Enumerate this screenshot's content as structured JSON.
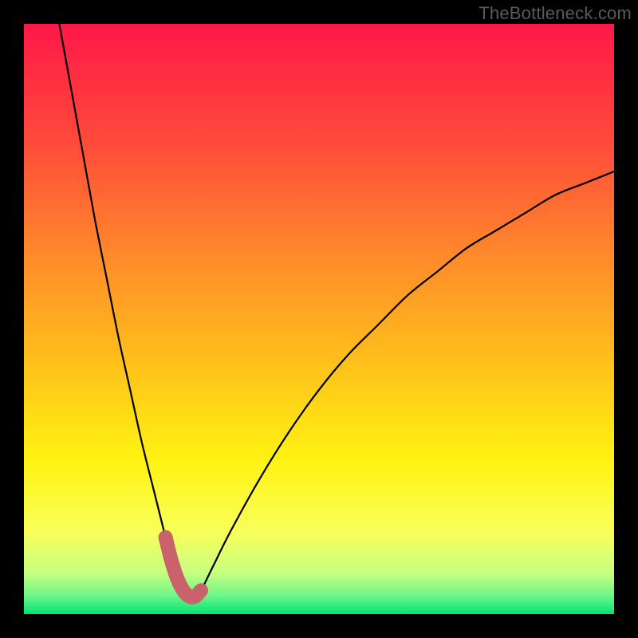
{
  "watermark": "TheBottleneck.com",
  "gradient": {
    "stops": [
      {
        "offset": 0.0,
        "color": "#ff1848"
      },
      {
        "offset": 0.2,
        "color": "#ff4a3a"
      },
      {
        "offset": 0.4,
        "color": "#ff8c2a"
      },
      {
        "offset": 0.58,
        "color": "#ffc21a"
      },
      {
        "offset": 0.74,
        "color": "#fff312"
      },
      {
        "offset": 0.86,
        "color": "#f8ff5a"
      },
      {
        "offset": 0.93,
        "color": "#c8ff80"
      },
      {
        "offset": 0.97,
        "color": "#6af588"
      },
      {
        "offset": 1.0,
        "color": "#00e574"
      }
    ]
  },
  "chart_data": {
    "type": "line",
    "title": "",
    "xlabel": "",
    "ylabel": "",
    "xlim": [
      0,
      100
    ],
    "ylim": [
      0,
      100
    ],
    "series": [
      {
        "name": "bottleneck-curve",
        "x": [
          6,
          8,
          10,
          12,
          14,
          16,
          18,
          20,
          22,
          24,
          25,
          26,
          27,
          28,
          29,
          30,
          32,
          35,
          40,
          45,
          50,
          55,
          60,
          65,
          70,
          75,
          80,
          85,
          90,
          95,
          100
        ],
        "values": [
          100,
          89,
          78,
          67,
          57,
          47,
          38,
          29,
          21,
          13,
          9,
          6,
          4,
          3,
          3,
          4,
          8,
          14,
          23,
          31,
          38,
          44,
          49,
          54,
          58,
          62,
          65,
          68,
          71,
          73,
          75
        ]
      }
    ],
    "highlight": {
      "name": "minimum-band",
      "color": "#c9626b",
      "x_range": [
        23.5,
        31.5
      ],
      "y_threshold": 12
    }
  }
}
